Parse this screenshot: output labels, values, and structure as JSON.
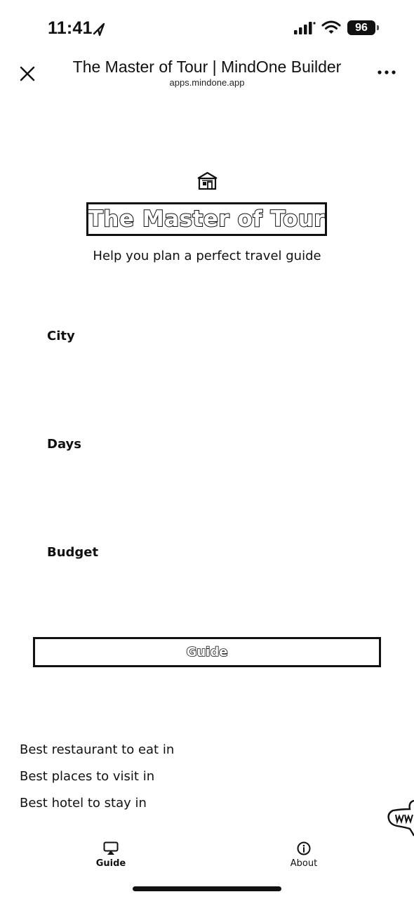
{
  "status_bar": {
    "time": "11:41",
    "battery": "96"
  },
  "browser": {
    "title": "The Master of Tour | MindOne Builder",
    "url": "apps.mindone.app"
  },
  "app": {
    "title": "The Master of Tour",
    "subtitle": "Help you plan a perfect travel guide",
    "fields": {
      "city_label": "City",
      "days_label": "Days",
      "budget_label": "Budget"
    },
    "guide_button": "Guide",
    "suggestions": [
      "Best restaurant to eat in",
      "Best places to visit in",
      "Best hotel to stay in"
    ]
  },
  "tabs": [
    {
      "label": "Guide",
      "icon": "airplay-icon",
      "active": true
    },
    {
      "label": "About",
      "icon": "info-icon",
      "active": false
    }
  ],
  "colors": {
    "background": "#ffffff",
    "foreground": "#111111"
  }
}
